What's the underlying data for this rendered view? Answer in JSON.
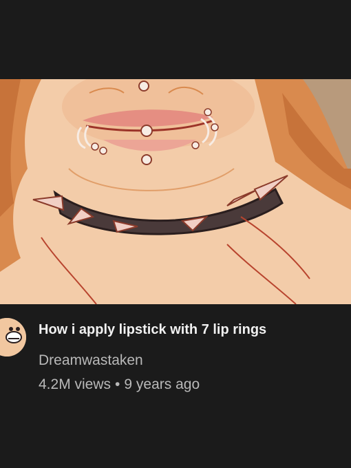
{
  "video": {
    "title": "How i apply lipstick with 7 lip rings",
    "channel": "Dreamwastaken",
    "views": "4.2M views",
    "separator": "•",
    "age": "9 years ago"
  },
  "colors": {
    "background": "#1b1b1b",
    "title_text": "#f1f1f1",
    "secondary_text": "#b9b9b9",
    "skin": "#f1c8a6",
    "hair": "#d98a4e",
    "collar": "#4a3a3a"
  },
  "icons": {
    "avatar": "channel-avatar-icon"
  }
}
